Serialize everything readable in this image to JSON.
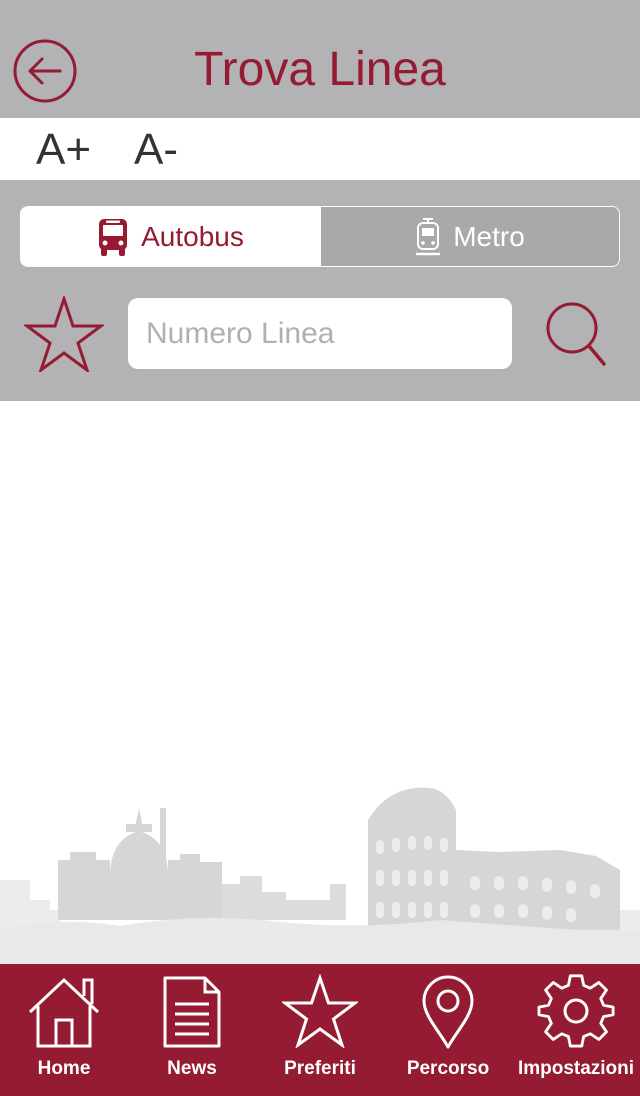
{
  "header": {
    "title": "Trova Linea",
    "back_icon": "arrow-left-circle-icon"
  },
  "font_controls": {
    "increase_label": "A+",
    "decrease_label": "A-"
  },
  "mode_selector": {
    "options": [
      {
        "label": "Autobus",
        "icon": "bus-icon",
        "selected": true
      },
      {
        "label": "Metro",
        "icon": "metro-icon",
        "selected": false
      }
    ]
  },
  "search": {
    "placeholder": "Numero Linea",
    "value": "",
    "favorite_icon": "star-icon",
    "search_icon": "search-icon"
  },
  "tabbar": {
    "items": [
      {
        "label": "Home",
        "icon": "home-icon"
      },
      {
        "label": "News",
        "icon": "news-icon"
      },
      {
        "label": "Preferiti",
        "icon": "star-icon"
      },
      {
        "label": "Percorso",
        "icon": "map-pin-icon"
      },
      {
        "label": "Impostazioni",
        "icon": "gear-icon"
      }
    ]
  },
  "colors": {
    "brand": "#951b32",
    "panel_gray": "#b3b2b4",
    "white": "#ffffff"
  }
}
